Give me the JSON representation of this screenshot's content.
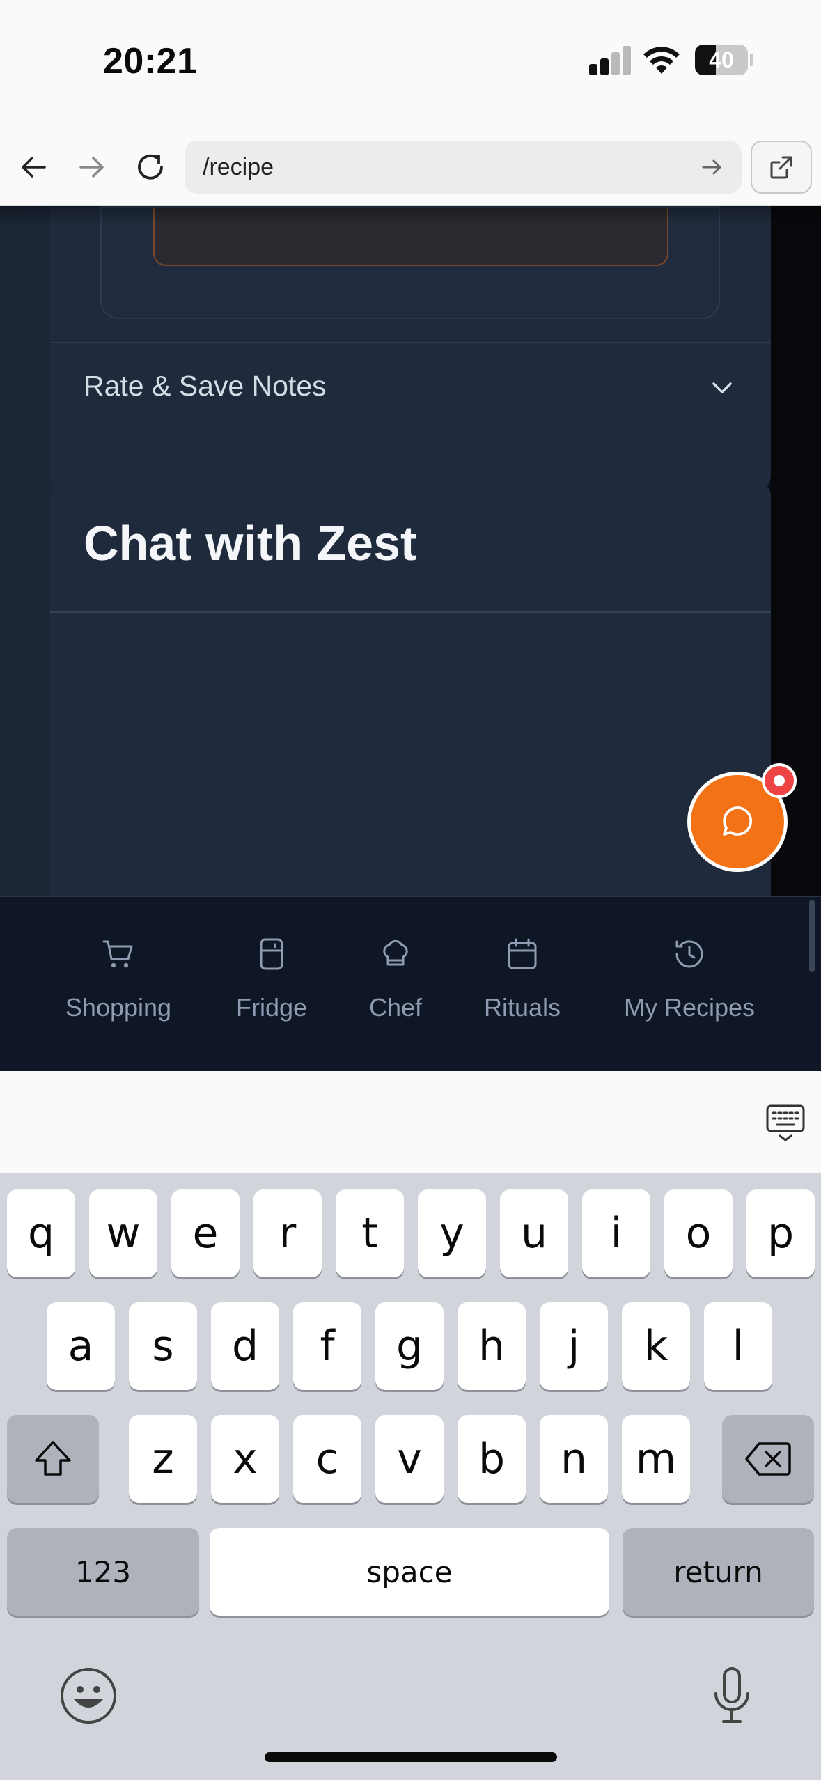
{
  "status_bar": {
    "time": "20:21",
    "battery_percent": "40",
    "battery_level": 0.4,
    "signal_bars_active": 2,
    "signal_bars_total": 4
  },
  "browser": {
    "url": "/recipe"
  },
  "app": {
    "accordion_label": "Rate & Save Notes",
    "chat_title": "Chat with Zest",
    "colors": {
      "accent": "#f47216",
      "badge": "#ef4444",
      "card": "#1f2a3c",
      "nav_bg": "#0f1727"
    }
  },
  "bottom_nav": [
    {
      "label": "Shopping",
      "icon": "cart-icon"
    },
    {
      "label": "Fridge",
      "icon": "fridge-icon"
    },
    {
      "label": "Chef",
      "icon": "chef-hat-icon"
    },
    {
      "label": "Rituals",
      "icon": "calendar-icon"
    },
    {
      "label": "My Recipes",
      "icon": "history-icon"
    }
  ],
  "keyboard": {
    "row1": [
      "q",
      "w",
      "e",
      "r",
      "t",
      "y",
      "u",
      "i",
      "o",
      "p"
    ],
    "row2": [
      "a",
      "s",
      "d",
      "f",
      "g",
      "h",
      "j",
      "k",
      "l"
    ],
    "row3": [
      "z",
      "x",
      "c",
      "v",
      "b",
      "n",
      "m"
    ],
    "numbers_label": "123",
    "space_label": "space",
    "return_label": "return"
  }
}
